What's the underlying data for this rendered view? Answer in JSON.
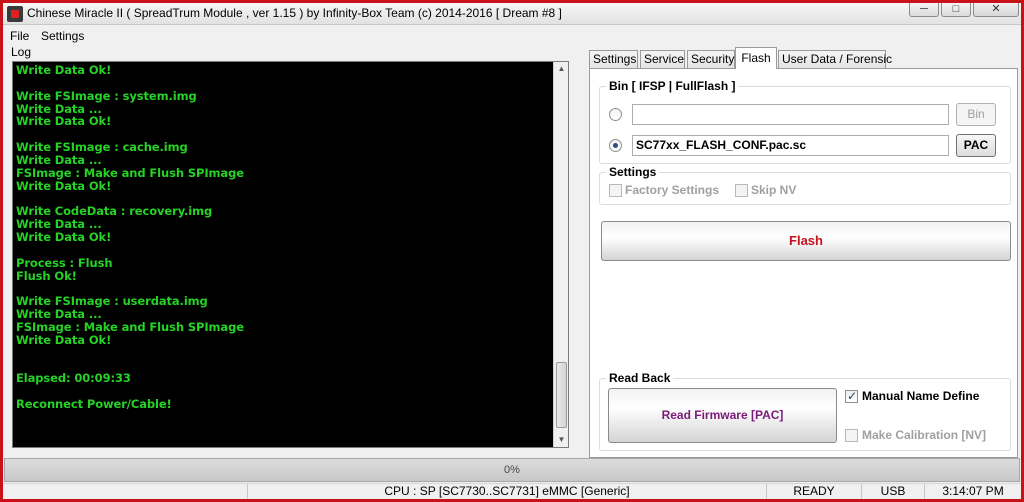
{
  "window": {
    "title": "Chinese Miracle II ( SpreadTrum Module , ver 1.15 ) by Infinity-Box Team (c) 2014-2016 [ Dream #8 ]",
    "minimize_glyph": "─",
    "maximize_glyph": "□",
    "close_glyph": "✕"
  },
  "menu": {
    "file": "File",
    "settings": "Settings"
  },
  "log": {
    "label": "Log",
    "lines": [
      "Write Data Ok!",
      "",
      "Write FSImage : system.img",
      "Write Data ...",
      "Write Data Ok!",
      "",
      "Write FSImage : cache.img",
      "Write Data ...",
      "FSImage : Make and Flush SPImage",
      "Write Data Ok!",
      "",
      "Write CodeData : recovery.img",
      "Write Data ...",
      "Write Data Ok!",
      "",
      "Process : Flush",
      "Flush Ok!",
      "",
      "Write FSImage : userdata.img",
      "Write Data ...",
      "FSImage : Make and Flush SPImage",
      "Write Data Ok!",
      "",
      "",
      "Elapsed: 00:09:33",
      "",
      "Reconnect Power/Cable!"
    ]
  },
  "tabs": [
    "Settings",
    "Service",
    "Security",
    "Flash",
    "User Data / Forensic"
  ],
  "flash": {
    "bin_group_title": "Bin  [ IFSP | FullFlash ]",
    "bin_path_value": "",
    "bin_button": "Bin",
    "pac_path_value": "SC77xx_FLASH_CONF.pac.sc",
    "pac_button": "PAC",
    "settings_group_title": "Settings",
    "factory_settings_label": "Factory Settings",
    "skip_nv_label": "Skip NV",
    "flash_button": "Flash",
    "readback_group_title": "Read Back",
    "read_firmware_button": "Read Firmware [PAC]",
    "manual_name_label": "Manual Name Define",
    "make_calibration_label": "Make Calibration [NV]"
  },
  "progress": {
    "text": "0%",
    "value": 0
  },
  "status": {
    "cpu": "CPU : SP [SC7730..SC7731] eMMC [Generic]",
    "state": "READY",
    "connection": "USB",
    "time": "3:14:07 PM"
  }
}
